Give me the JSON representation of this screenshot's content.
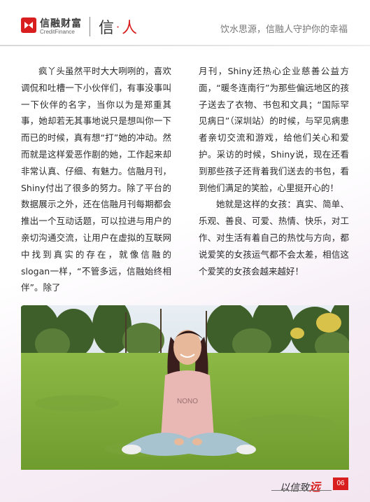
{
  "header": {
    "brand_cn": "信融财富",
    "brand_en": "CreditFinance",
    "section_char_1": "信",
    "section_dot": "·",
    "section_char_2": "人",
    "slogan": "饮水思源，信融人守护你的幸福"
  },
  "article": {
    "left_column": [
      "疯丫头虽然平时大大咧咧的，喜欢调侃和吐槽一下小伙伴们，有事没事叫一下伙伴的名字，当你以为是郑重其事，她却若无其事地说只是想叫你一下而已的时候，真有想“打”她的冲动。然而就是这样爱恶作剧的她，工作起来却非常认真、仔细、有魅力。信融月刊，Shiny付出了很多的努力。除了平台的数据展示之外，还在信融月刊每期都会推出一个互动话题，可以拉进与用户的亲切沟通交流，让用户在虚拟的互联网中找到真实的存在，就像信融的slogan一样，“不管多远，信融始终相伴”。除了"
    ],
    "right_column_cont": "月刊，Shiny还热心企业慈善公益方面，“暖冬连南行”为那些偏远地区的孩子送去了衣物、书包和文具；“国际罕见病日”（深圳站）的时候，与罕见病患者亲切交流和游戏，给他们关心和爱护。采访的时候，Shiny说，现在还看到那些孩子还背着我们送去的书包，看到他们满足的笑脸，心里挺开心的！",
    "right_column_para": "她就是这样的女孩：真实、简单、乐观、善良、可爱、热情、快乐，对工作、对生活有着自己的热忱与方向，都说爱笑的女孩运气都不会太差，相信这个爱笑的女孩会越来越好！"
  },
  "photo": {
    "sweater_text": "NONO"
  },
  "footer": {
    "signature_prefix": "以信致",
    "signature_accent": "远",
    "page_number": "06"
  },
  "colors": {
    "brand_red": "#d81e1e",
    "grass": "#7fae3a",
    "sky": "#dfe8f0"
  }
}
